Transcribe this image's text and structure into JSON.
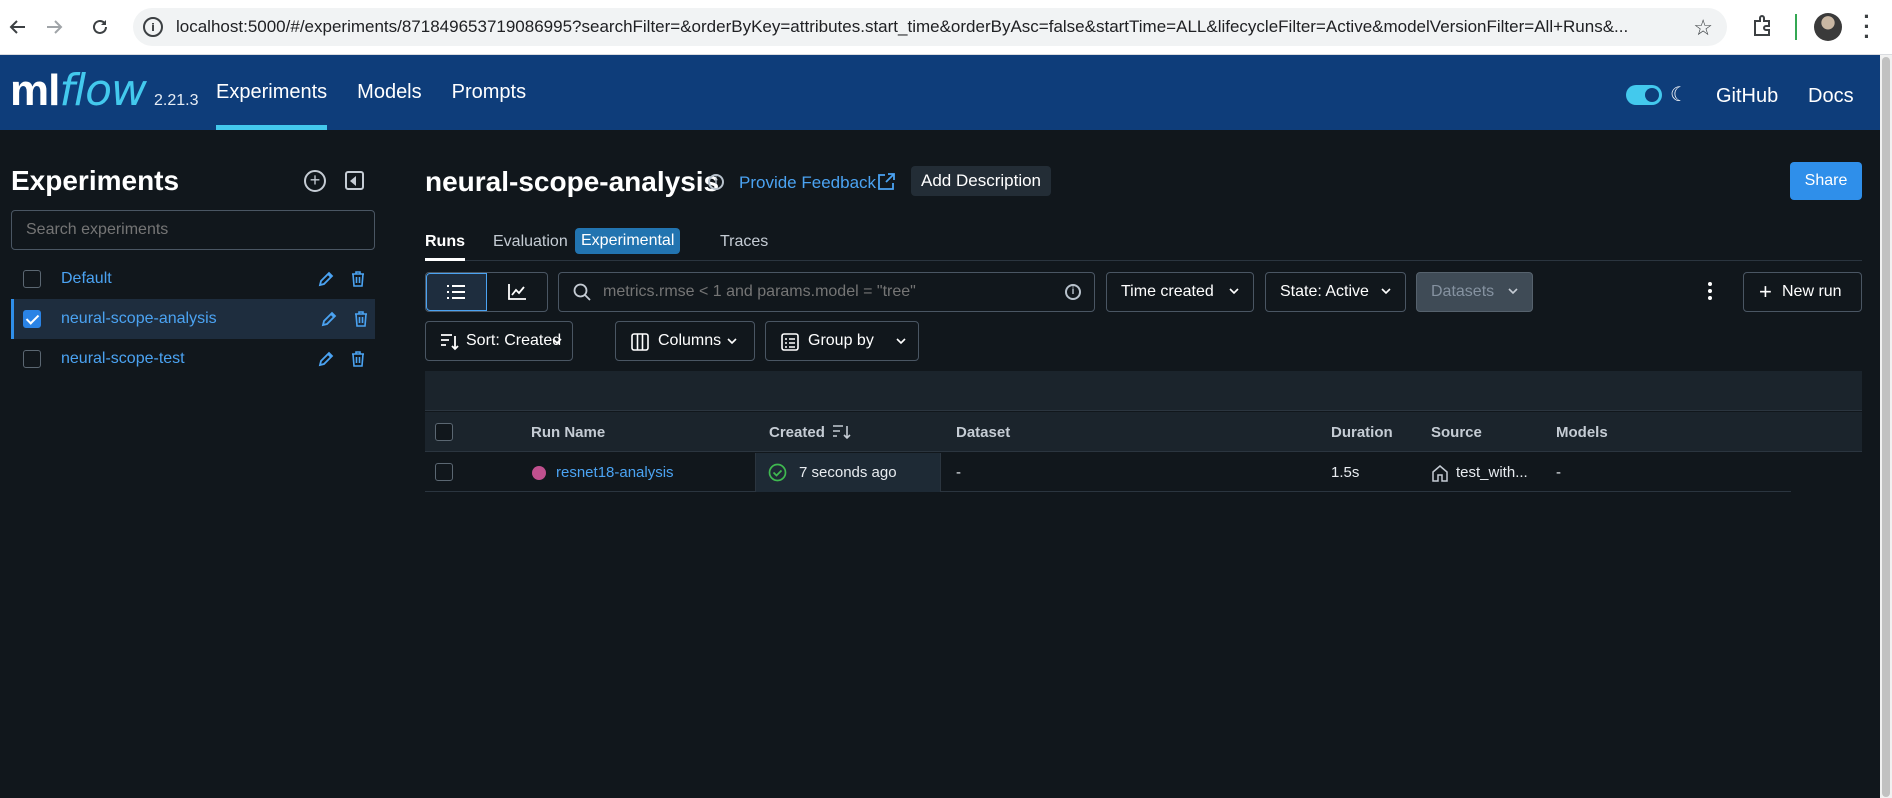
{
  "browser": {
    "url": "localhost:5000/#/experiments/871849653719086995?searchFilter=&orderByKey=attributes.start_time&orderByAsc=false&startTime=ALL&lifecycleFilter=Active&modelVersionFilter=All+Runs&..."
  },
  "header": {
    "logo_ml": "ml",
    "logo_flow": "flow",
    "version": "2.21.3",
    "nav": [
      "Experiments",
      "Models",
      "Prompts"
    ],
    "active_nav": "Experiments",
    "github": "GitHub",
    "docs": "Docs"
  },
  "sidebar": {
    "title": "Experiments",
    "search_placeholder": "Search experiments",
    "items": [
      {
        "label": "Default",
        "checked": false
      },
      {
        "label": "neural-scope-analysis",
        "checked": true
      },
      {
        "label": "neural-scope-test",
        "checked": false
      }
    ]
  },
  "main": {
    "title": "neural-scope-analysis",
    "feedback": "Provide Feedback",
    "add_description": "Add Description",
    "share": "Share",
    "tabs": {
      "runs": "Runs",
      "evaluation": "Evaluation",
      "experimental_badge": "Experimental",
      "traces": "Traces"
    },
    "search_placeholder": "metrics.rmse < 1 and params.model = \"tree\"",
    "time_filter": "Time created",
    "state_filter": "State: Active",
    "datasets_filter": "Datasets",
    "new_run": "New run",
    "sort": "Sort: Created",
    "columns": "Columns",
    "group_by": "Group by"
  },
  "table": {
    "headers": {
      "run_name": "Run Name",
      "created": "Created",
      "dataset": "Dataset",
      "duration": "Duration",
      "source": "Source",
      "models": "Models"
    },
    "rows": [
      {
        "run_name": "resnet18-analysis",
        "created": "7 seconds ago",
        "dataset": "-",
        "duration": "1.5s",
        "source": "test_with...",
        "models": "-"
      }
    ]
  },
  "colors": {
    "app_bar": "#0e3d7a",
    "accent": "#43c9ed",
    "link": "#4ba3f2",
    "primary": "#2f8fea",
    "run_color": "#c0508e",
    "success": "#3fb950"
  }
}
